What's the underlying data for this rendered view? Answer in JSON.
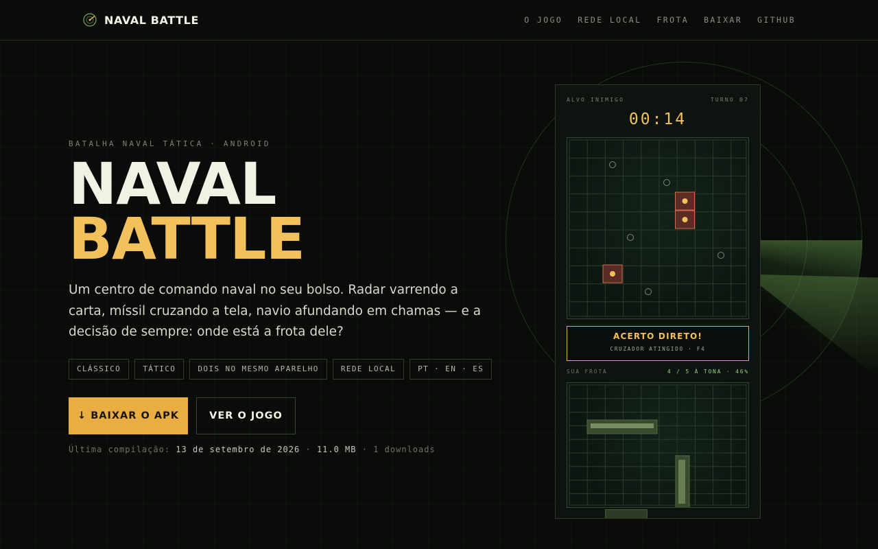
{
  "header": {
    "brand": "NAVAL BATTLE",
    "nav": [
      "O JOGO",
      "REDE LOCAL",
      "FROTA",
      "BAIXAR",
      "GITHUB"
    ]
  },
  "hero": {
    "eyebrow": "BATALHA NAVAL TÁTICA · ANDROID",
    "title_line1": "NAVAL",
    "title_line2": "BATTLE",
    "lede": "Um centro de comando naval no seu bolso. Radar varrendo a carta, míssil cruzando a tela, navio afundando em chamas — e a decisão de sempre: onde está a frota dele?",
    "chips": [
      "CLÁSSICO",
      "TÁTICO",
      "DOIS NO MESMO APARELHO",
      "REDE LOCAL",
      "PT · EN · ES"
    ],
    "primary_button": "↓ BAIXAR O APK",
    "secondary_button": "VER O JOGO",
    "build_label": "Última compilação:",
    "build_date": "13 de setembro de 2026",
    "build_sep1": "·",
    "build_size": "11.0 MB",
    "build_sep2": "·",
    "build_downloads": "1 downloads"
  },
  "phone": {
    "target_label": "ALVO INIMIGO",
    "turn_label": "TURNO 07",
    "timer": "00:14",
    "alert_title": "ACERTO DIRETO!",
    "alert_sub": "CRUZADOR ATINGIDO · F4",
    "fleet_label": "SUA FROTA",
    "fleet_status": "4 / 5 À TONA · 46%"
  },
  "colors": {
    "accent": "#f3c15c",
    "button": "#e8ae43",
    "background": "#0a0c09",
    "fleet_status": "#9bd07a"
  },
  "icons": {
    "brand": "radar-icon",
    "download": "arrow-down-icon"
  }
}
